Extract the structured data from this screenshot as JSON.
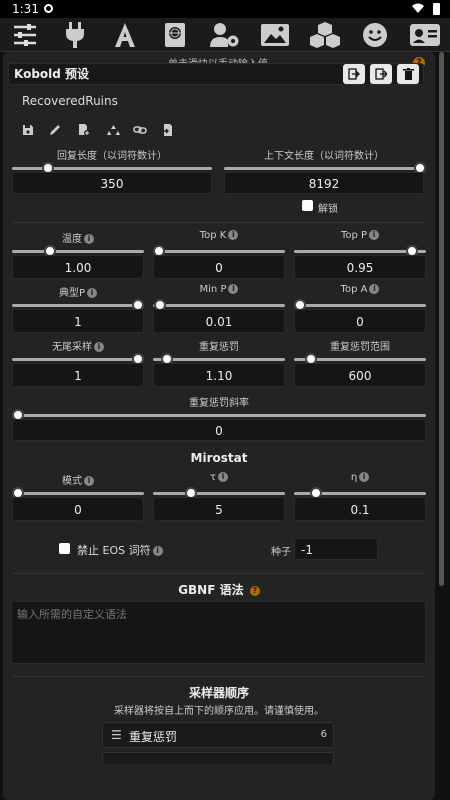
{
  "status": {
    "time": "1:31"
  },
  "topbar": {
    "icons": [
      "sliders-icon",
      "plug-icon",
      "font-icon",
      "book-globe-icon",
      "user-gear-icon",
      "image-icon",
      "cubes-icon",
      "smile-icon",
      "contact-card-icon"
    ]
  },
  "preset": {
    "label": "Kobold 预设",
    "hint": "单击滑块以手动输入值。",
    "selected": "RecoveredRuins"
  },
  "sliders_top": [
    {
      "id": "response-length",
      "label": "回复长度（以词符数计）",
      "value": "350",
      "pos": 0.12
    },
    {
      "id": "context-length",
      "label": "上下文长度（以词符数计）",
      "value": "8192",
      "pos": 0.99
    }
  ],
  "unlock": {
    "label": "解锁"
  },
  "grid": [
    {
      "label": "温度",
      "value": "1.00",
      "pos": 0.27,
      "info": true
    },
    {
      "label": "Top K",
      "value": "0",
      "pos": 0.0,
      "info": true
    },
    {
      "label": "Top P",
      "value": "0.95",
      "pos": 0.93,
      "info": true
    },
    {
      "label": "典型P",
      "value": "1",
      "pos": 1.0,
      "info": true
    },
    {
      "label": "Min P",
      "value": "0.01",
      "pos": 0.01,
      "info": true
    },
    {
      "label": "Top A",
      "value": "0",
      "pos": 0.0,
      "info": true
    },
    {
      "label": "无尾采样",
      "value": "1",
      "pos": 1.0,
      "info": true
    },
    {
      "label": "重复惩罚",
      "value": "1.10",
      "pos": 0.07,
      "info": false
    },
    {
      "label": "重复惩罚范围",
      "value": "600",
      "pos": 0.09,
      "info": false
    }
  ],
  "slope": {
    "label": "重复惩罚斜率",
    "value": "0",
    "pos": 0.0
  },
  "mirostat": {
    "title": "Mirostat",
    "items": [
      {
        "label": "模式",
        "value": "0",
        "pos": 0.0
      },
      {
        "label": "τ",
        "value": "5",
        "pos": 0.27
      },
      {
        "label": "η",
        "value": "0.1",
        "pos": 0.13
      }
    ]
  },
  "eos": {
    "label": "禁止 EOS 词符"
  },
  "seed": {
    "label": "种子",
    "value": "-1"
  },
  "gbnf": {
    "title": "GBNF 语法",
    "placeholder": "输入所需的自定义语法"
  },
  "sampler_order": {
    "title": "采样器顺序",
    "desc": "采样器将按自上而下的顺序应用。请谨慎使用。",
    "first_item": "重复惩罚",
    "first_index": "6"
  }
}
